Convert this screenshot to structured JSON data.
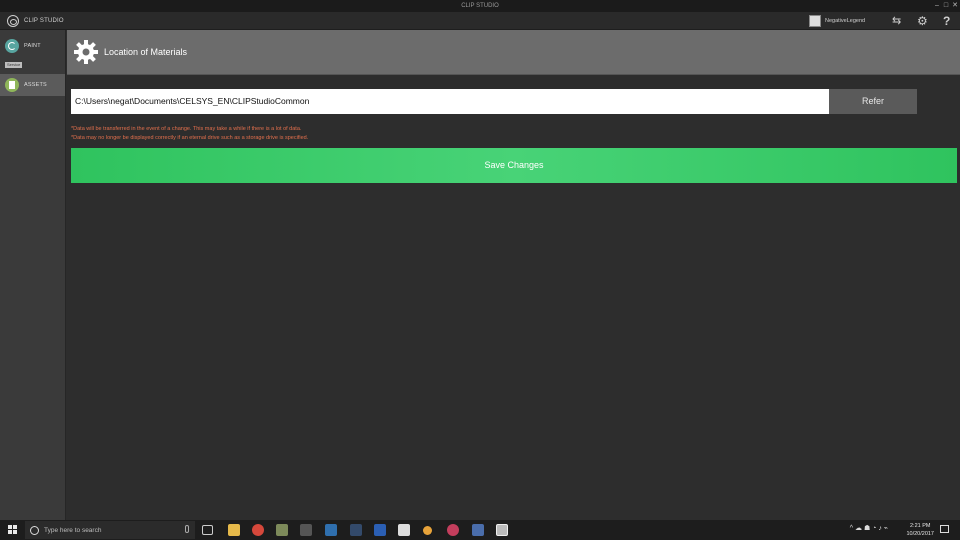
{
  "window": {
    "title": "CLIP STUDIO"
  },
  "app_header": {
    "brand": "CLIP STUDIO",
    "user_name": "NegativeLegend",
    "icons": [
      "transfer-icon",
      "gear-icon",
      "help-icon"
    ]
  },
  "sidebar": {
    "items": [
      {
        "label": "PAINT",
        "icon": "paint-icon"
      },
      {
        "label": "ASSETS",
        "icon": "assets-icon"
      }
    ],
    "tooltip": "Service"
  },
  "page": {
    "title": "Location of Materials",
    "path_value": "C:\\Users\\negat\\Documents\\CELSYS_EN\\CLIPStudioCommon",
    "refer_label": "Refer",
    "notes": [
      "*Data will be transferred in the event of a change. This may take a while if there is a lot of data.",
      "*Data may no longer be displayed correctly if an eternal drive such as a storage drive is specified."
    ],
    "save_label": "Save Changes"
  },
  "taskbar": {
    "search_placeholder": "Type here to search",
    "time": "2:21 PM",
    "date": "10/20/2017"
  },
  "colors": {
    "save_green": "#3acc69",
    "note_orange": "#e3704d",
    "header_gray": "#6c6c6c"
  }
}
